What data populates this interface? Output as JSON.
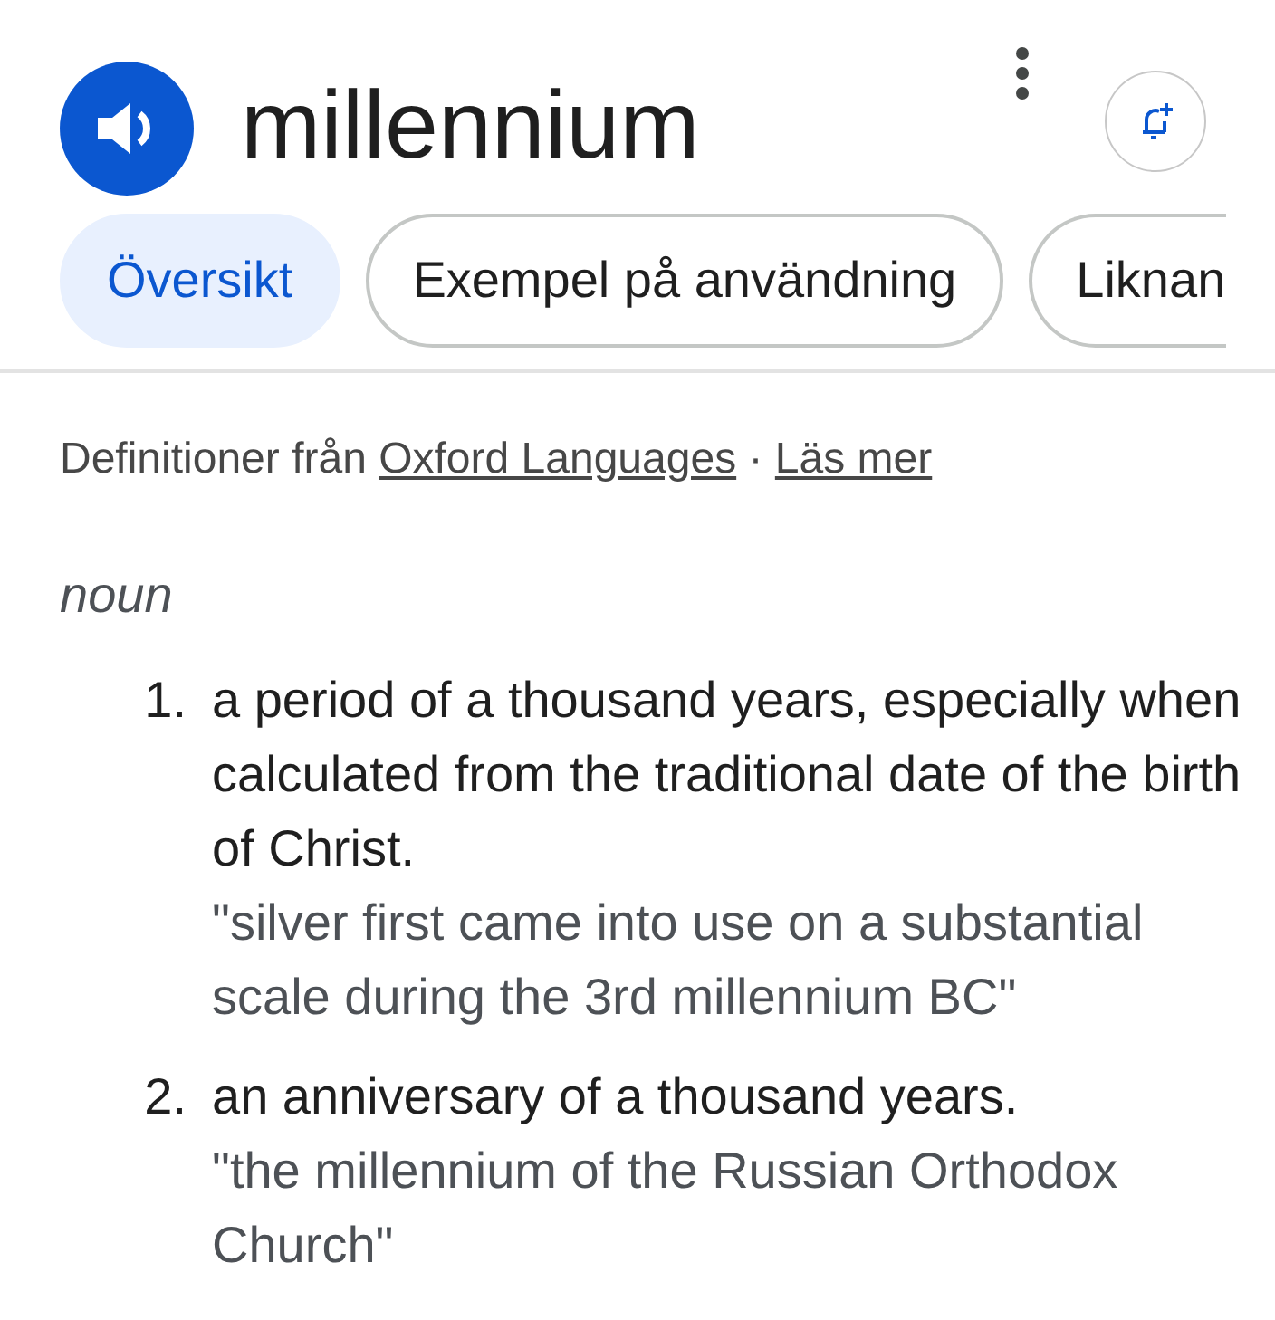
{
  "header": {
    "word": "millennium"
  },
  "tabs": [
    {
      "label": "Översikt",
      "selected": true,
      "cut": false
    },
    {
      "label": "Exempel på användning",
      "selected": false,
      "cut": false
    },
    {
      "label": "Liknan",
      "selected": false,
      "cut": true
    }
  ],
  "source": {
    "prefix": "Definitioner från",
    "link": "Oxford Languages",
    "separator": "·",
    "more": "Läs mer"
  },
  "part_of_speech": "noun",
  "senses": [
    {
      "number": "1.",
      "definition": "a period of a thousand years, especially when calculated from the traditional date of the birth of Christ.",
      "example": "\"silver first came into use on a substantial scale during the 3rd millennium BC\""
    },
    {
      "number": "2.",
      "definition": "an anniversary of a thousand years.",
      "example": "\"the millennium of the Russian Orthodox Church\""
    }
  ]
}
